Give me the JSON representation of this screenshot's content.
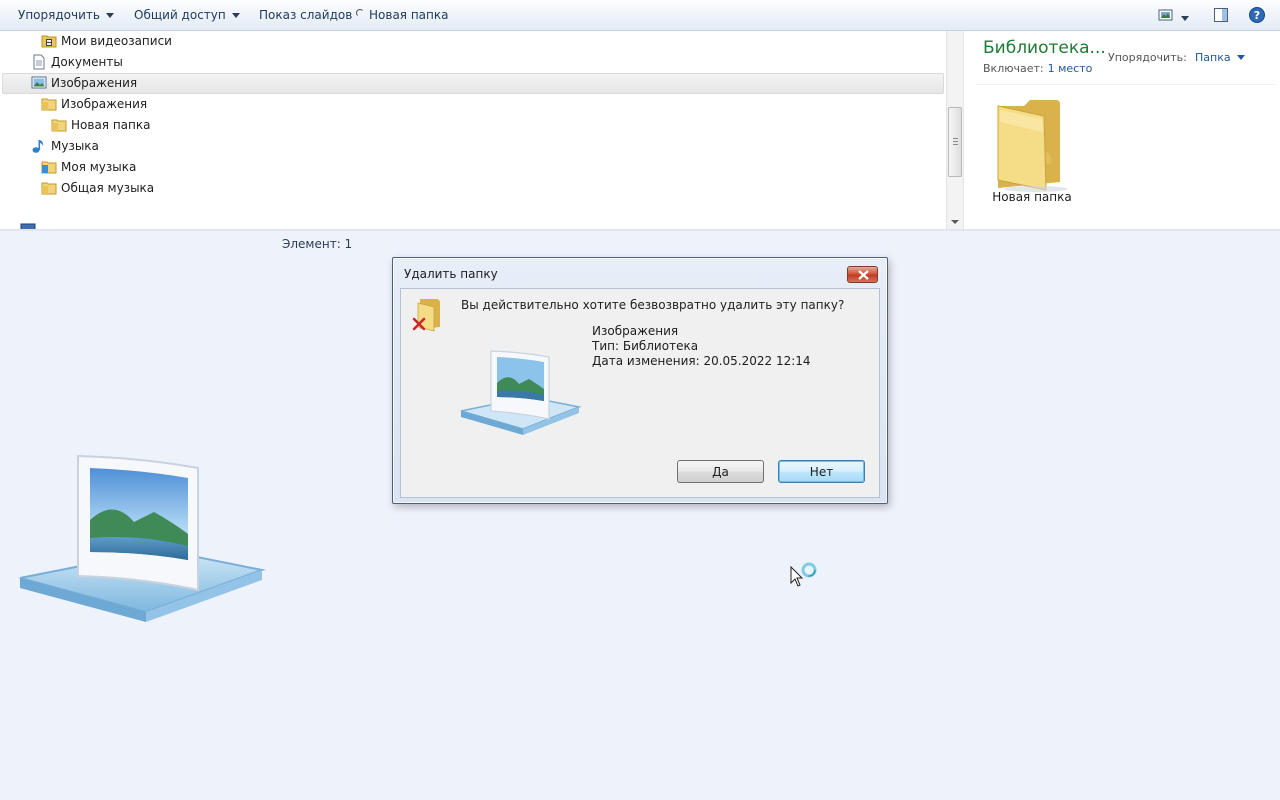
{
  "toolbar": {
    "organize": "Упорядочить",
    "share": "Общий доступ",
    "slideshow": "Показ слайдов",
    "new_folder": "Новая папка"
  },
  "nav_tree": {
    "items": [
      {
        "label": "Мои видеозаписи",
        "icon": "video-library-icon"
      },
      {
        "label": "Документы",
        "icon": "documents-icon"
      },
      {
        "label": "Изображения",
        "icon": "pictures-library-icon"
      },
      {
        "label": "Изображения",
        "icon": "folder-icon"
      },
      {
        "label": "Новая папка",
        "icon": "folder-icon"
      },
      {
        "label": "Музыка",
        "icon": "music-icon"
      },
      {
        "label": "Моя музыка",
        "icon": "folder-icon"
      },
      {
        "label": "Общая музыка",
        "icon": "folder-icon"
      }
    ],
    "selected_index": 2
  },
  "preview": {
    "title": "Библиотека...",
    "includes_label": "Включает:",
    "includes_link": "1 место",
    "arrange_label": "Упорядочить:",
    "arrange_value": "Папка",
    "folder_label": "Новая папка"
  },
  "status": {
    "elements": "Элемент: 1"
  },
  "dialog": {
    "title": "Удалить папку",
    "question": "Вы действительно хотите безвозвратно удалить эту папку?",
    "item_name": "Изображения",
    "item_type": "Тип: Библиотека",
    "item_date": "Дата изменения: 20.05.2022 12:14",
    "yes": "Да",
    "no": "Нет"
  },
  "colors": {
    "library_title": "#1e7a34",
    "link": "#1e58a0",
    "close_button": "#c13c22"
  }
}
